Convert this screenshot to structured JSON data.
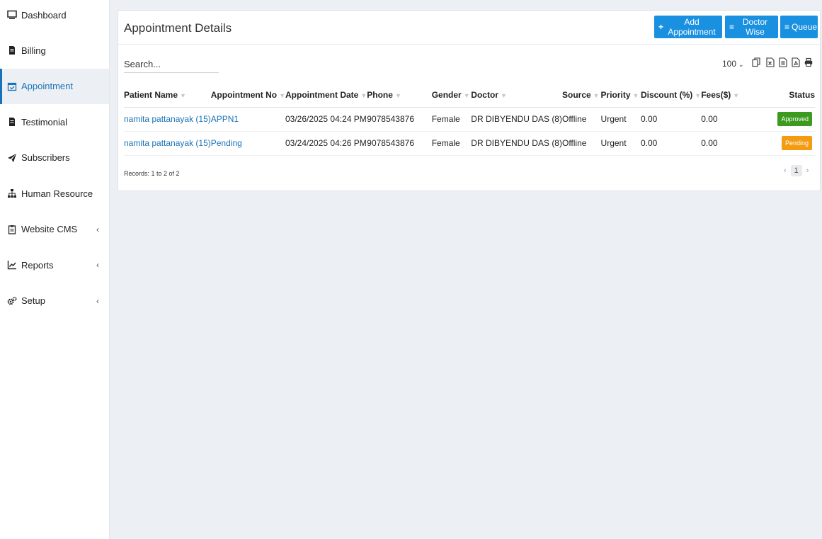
{
  "sidebar": {
    "items": [
      {
        "label": "Dashboard",
        "icon": "monitor-icon"
      },
      {
        "label": "Billing",
        "icon": "file-icon"
      },
      {
        "label": "Appointment",
        "icon": "calendar-check-icon"
      },
      {
        "label": "Testimonial",
        "icon": "file-icon"
      },
      {
        "label": "Subscribers",
        "icon": "paper-plane-icon"
      },
      {
        "label": "Human Resource",
        "icon": "sitemap-icon"
      },
      {
        "label": "Website CMS",
        "icon": "clipboard-icon",
        "chevron": "‹"
      },
      {
        "label": "Reports",
        "icon": "chart-line-icon",
        "chevron": "‹"
      },
      {
        "label": "Setup",
        "icon": "cogs-icon",
        "chevron": "‹"
      }
    ]
  },
  "header": {
    "title": "Appointment Details",
    "add_label": "Add Appointment",
    "add_icon": "+",
    "doctor_label": "Doctor Wise",
    "doctor_icon": "≡",
    "queue_label": "Queue",
    "queue_icon": "≡"
  },
  "toolbar": {
    "search_placeholder": "Search...",
    "page_size": "100",
    "page_caret": "⌄"
  },
  "table": {
    "columns": [
      "Patient Name",
      "Appointment No",
      "Appointment Date",
      "Phone",
      "Gender",
      "Doctor",
      "Source",
      "Priority",
      "Discount (%)",
      "Fees($)",
      "Status"
    ],
    "rows": [
      {
        "patient": "namita pattanayak (15)",
        "appt_no": "APPN1",
        "date": "03/26/2025 04:24 PM",
        "phone": "9078543876",
        "gender": "Female",
        "doctor": "DR DIBYENDU DAS (8)",
        "source": "Offline",
        "priority": "Urgent",
        "discount": "0.00",
        "fees": "0.00",
        "status": "Approved"
      },
      {
        "patient": "namita pattanayak (15)",
        "appt_no": "Pending",
        "date": "03/24/2025 04:26 PM",
        "phone": "9078543876",
        "gender": "Female",
        "doctor": "DR DIBYENDU DAS (8)",
        "source": "Offline",
        "priority": "Urgent",
        "discount": "0.00",
        "fees": "0.00",
        "status": "Pending"
      }
    ]
  },
  "footer": {
    "records": "Records: 1 to 2 of 2",
    "prev": "‹",
    "page": "1",
    "next": "›"
  },
  "colors": {
    "accent": "#1a90e0",
    "link": "#1a73b8",
    "approved": "#3c9a1e",
    "pending": "#f39c12"
  }
}
